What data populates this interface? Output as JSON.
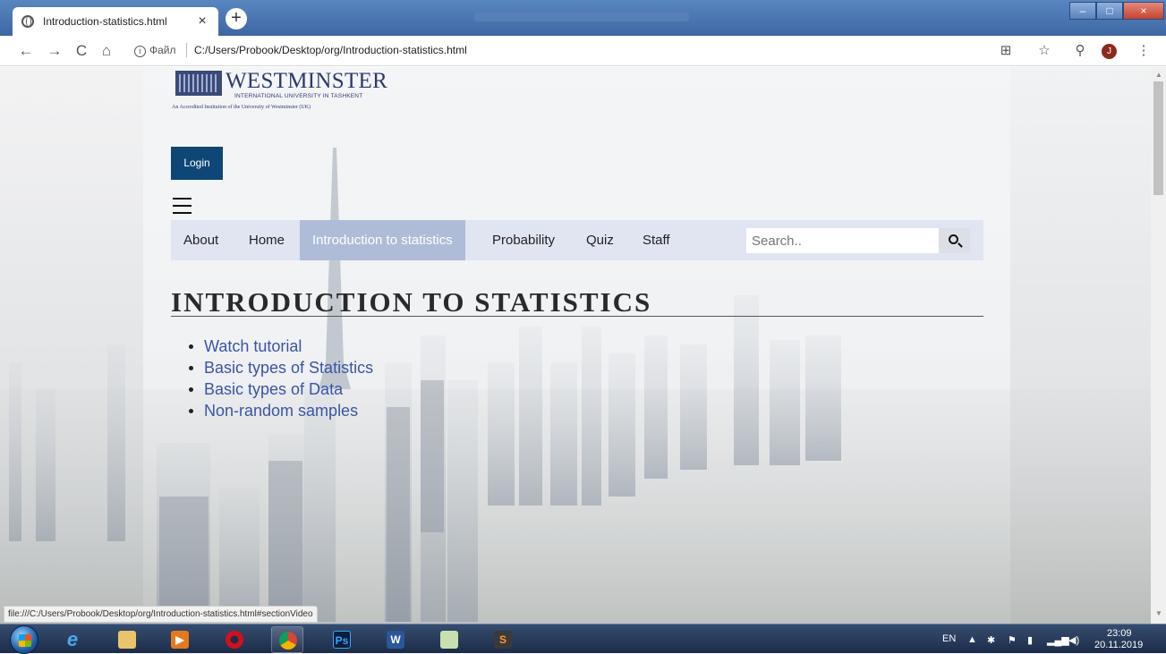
{
  "browser": {
    "tab_title": "Introduction-statistics.html",
    "tab_close": "×",
    "new_tab": "+",
    "url_scheme_label": "Файл",
    "url": "C:/Users/Probook/Desktop/org/Introduction-statistics.html",
    "info_icon": "i",
    "avatar_letter": "J",
    "window_controls": [
      "–",
      "□",
      "×"
    ],
    "status_url": "file:///C:/Users/Probook/Desktop/org/Introduction-statistics.html#sectionVideo"
  },
  "logo": {
    "name": "WESTMINSTER",
    "subtitle": "INTERNATIONAL UNIVERSITY IN TASHKENT",
    "tagline": "An Accredited Institution of the University of Westminster (UK)"
  },
  "header": {
    "login_label": "Login"
  },
  "nav": {
    "items": [
      {
        "label": "About",
        "active": false
      },
      {
        "label": "Home",
        "active": false
      },
      {
        "label": "Introduction to statistics",
        "active": true
      },
      {
        "label": "Probability",
        "active": false
      },
      {
        "label": "Quiz",
        "active": false
      },
      {
        "label": "Staff",
        "active": false
      }
    ],
    "search_placeholder": "Search.."
  },
  "main": {
    "title": "INTRODUCTION TO STATISTICS",
    "topics": [
      "Watch tutorial",
      "Basic types of Statistics",
      "Basic types of Data",
      "Non-random samples"
    ]
  },
  "taskbar": {
    "apps": [
      "start-orb",
      "internet-explorer-icon",
      "file-explorer-icon",
      "media-player-icon",
      "opera-icon",
      "chrome-icon",
      "photoshop-icon",
      "word-icon",
      "project-icon",
      "sublime-icon"
    ],
    "photoshop_label": "Ps",
    "word_label": "W",
    "language": "EN",
    "time": "23:09",
    "date": "20.11.2019"
  },
  "colors": {
    "login_bg": "#0e4775",
    "nav_active_bg": "#aebcd8",
    "link_color": "#3a55a5",
    "taskbar_bg": "#1c2d49"
  }
}
